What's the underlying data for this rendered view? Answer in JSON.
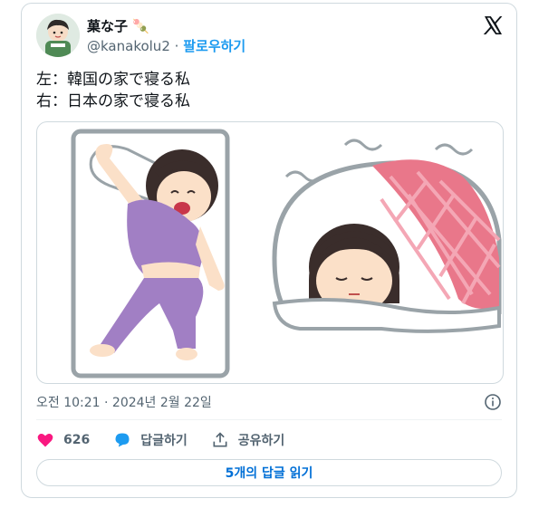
{
  "author": {
    "display_name": "菓な子 🍡",
    "handle": "@kanakolu2",
    "separator": "·",
    "follow_label": "팔로우하기"
  },
  "tweet": {
    "line1": "左：韓国の家で寝る私",
    "line2": "右：日本の家で寝る私",
    "timestamp": "오전 10:21 · 2024년 2월 22일"
  },
  "actions": {
    "like_count": "626",
    "reply_label": "답글하기",
    "share_label": "공유하기"
  },
  "read_replies_label": "5개의 답글 읽기",
  "colors": {
    "like": "#f91880",
    "reply": "#1d9bf0",
    "follow": "#1d9bf0",
    "read_replies": "#006fd6"
  }
}
